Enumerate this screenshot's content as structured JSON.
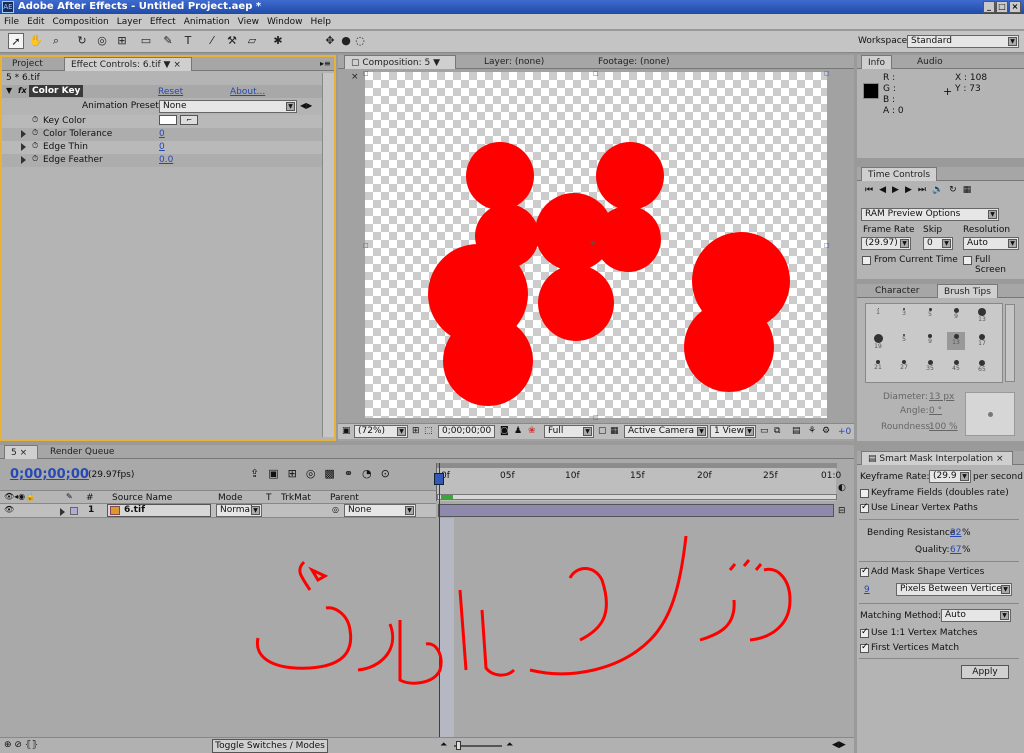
{
  "window": {
    "title": "Adobe After Effects - Untitled Project.aep *",
    "app_icon": "AE"
  },
  "menu": [
    "File",
    "Edit",
    "Composition",
    "Layer",
    "Effect",
    "Animation",
    "View",
    "Window",
    "Help"
  ],
  "workspace": {
    "label": "Workspace:",
    "value": "Standard"
  },
  "left_panel": {
    "tabs": [
      "Project",
      "Effect Controls: 6.tif"
    ],
    "layer_path": "5 * 6.tif",
    "effect": {
      "name": "Color Key",
      "reset": "Reset",
      "about": "About..."
    },
    "animation_presets": {
      "label": "Animation Presets:",
      "value": "None"
    },
    "params": [
      {
        "label": "Key Color",
        "value": ""
      },
      {
        "label": "Color Tolerance",
        "value": "0"
      },
      {
        "label": "Edge Thin",
        "value": "0"
      },
      {
        "label": "Edge Feather",
        "value": "0.0"
      }
    ]
  },
  "viewer": {
    "tabs": [
      "Composition: 5",
      "Layer: (none)",
      "Footage: (none)"
    ],
    "zoom": "(72%)",
    "timecode": "0;00;00;00",
    "resolution": "Full",
    "camera": "Active Camera",
    "view": "1 View",
    "exposure": "+0"
  },
  "info": {
    "tabs": [
      "Info",
      "Audio"
    ],
    "rgba": [
      "R :",
      "G :",
      "B :",
      "A : 0"
    ],
    "x": "X : 108",
    "y": "Y : 73"
  },
  "time_controls": {
    "title": "Time Controls",
    "ram_preview": "RAM Preview Options",
    "frame_rate_label": "Frame Rate",
    "frame_rate": "(29.97)",
    "skip_label": "Skip",
    "skip": "0",
    "resolution_label": "Resolution",
    "resolution": "Auto",
    "from_current": "From Current Time",
    "full_screen": "Full Screen"
  },
  "brush": {
    "tabs": [
      "Character",
      "Brush Tips"
    ],
    "sizes": [
      "1",
      "3",
      "5",
      "9",
      "13",
      "19",
      "5",
      "9",
      "13",
      "17",
      "21",
      "27",
      "35",
      "45",
      "65"
    ],
    "diameter": {
      "label": "Diameter:",
      "value": "13 px"
    },
    "angle": {
      "label": "Angle:",
      "value": "0 °"
    },
    "roundness": {
      "label": "Roundness:",
      "value": "100 %"
    }
  },
  "smart_mask": {
    "title": "Smart Mask Interpolation",
    "keyframe_rate_label": "Keyframe Rate:",
    "keyframe_rate": "(29.9",
    "per_second": "per second",
    "keyframe_fields": "Keyframe Fields (doubles rate)",
    "linear_vertex": "Use Linear Vertex Paths",
    "bending_label": "Bending Resistance:",
    "bending": "32",
    "quality_label": "Quality:",
    "quality": "67",
    "pct": "%",
    "add_vertices": "Add Mask Shape Vertices",
    "vertices_value": "9",
    "vertices_mode": "Pixels Between Vertices",
    "matching_label": "Matching Method:",
    "matching": "Auto",
    "one_to_one": "Use 1:1 Vertex Matches",
    "first_vertices": "First Vertices Match",
    "apply": "Apply"
  },
  "timeline": {
    "tabs": [
      "5",
      "Render Queue"
    ],
    "timecode": "0;00;00;00",
    "fps": "(29.97fps)",
    "columns": [
      "#",
      "Source Name",
      "Mode",
      "T",
      "TrkMat",
      "Parent"
    ],
    "layer": {
      "num": "1",
      "name": "6.tif",
      "mode": "Normal",
      "parent": "None"
    },
    "ruler": [
      "0f",
      "05f",
      "10f",
      "15f",
      "20f",
      "25f",
      "01:0"
    ],
    "toggle": "Toggle Switches / Modes"
  },
  "overlay": {
    "text": "الشكل النهائي",
    "color": "#ff0000"
  },
  "colors": {
    "accent": "#e8b23a",
    "link": "#2649b5",
    "shape": "#ff0000",
    "playhead": "#cc0000"
  }
}
